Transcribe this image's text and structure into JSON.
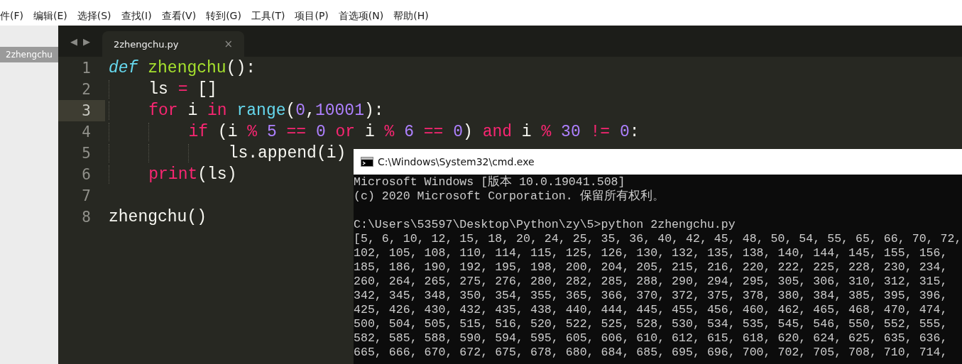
{
  "menu": [
    "件(F)",
    "编辑(E)",
    "选择(S)",
    "查找(I)",
    "查看(V)",
    "转到(G)",
    "工具(T)",
    "项目(P)",
    "首选项(N)",
    "帮助(H)"
  ],
  "sidebar": {
    "items": [
      {
        "label": "2zhengchu",
        "selected": true
      }
    ]
  },
  "tabs": [
    {
      "label": "2zhengchu.py",
      "selected": true,
      "close": "×"
    }
  ],
  "nav": [
    "◀",
    "▶"
  ],
  "code": [
    {
      "number": "1",
      "current": false,
      "tokens": [
        {
          "kind": "storage",
          "text": "def"
        },
        {
          "kind": "func",
          "text": " zhengchu"
        },
        {
          "kind": "plain",
          "text": "():"
        }
      ]
    },
    {
      "number": "2",
      "current": false,
      "tokens": [
        {
          "kind": "plain",
          "text": "    ls "
        },
        {
          "kind": "keyword",
          "text": "="
        },
        {
          "kind": "plain",
          "text": " []"
        }
      ]
    },
    {
      "number": "3",
      "current": true,
      "tokens": [
        {
          "kind": "keyword",
          "text": "    for"
        },
        {
          "kind": "plain",
          "text": " i "
        },
        {
          "kind": "keyword",
          "text": "in"
        },
        {
          "kind": "builtin",
          "text": " range"
        },
        {
          "kind": "plain",
          "text": "("
        },
        {
          "kind": "number",
          "text": "0"
        },
        {
          "kind": "plain",
          "text": ","
        },
        {
          "kind": "number",
          "text": "10001"
        },
        {
          "kind": "plain",
          "text": "):"
        }
      ]
    },
    {
      "number": "4",
      "current": false,
      "tokens": [
        {
          "kind": "keyword",
          "text": "        if"
        },
        {
          "kind": "plain",
          "text": " (i "
        },
        {
          "kind": "keyword",
          "text": "%"
        },
        {
          "kind": "number",
          "text": " 5"
        },
        {
          "kind": "keyword",
          "text": " =="
        },
        {
          "kind": "number",
          "text": " 0"
        },
        {
          "kind": "keyword",
          "text": " or"
        },
        {
          "kind": "plain",
          "text": " i "
        },
        {
          "kind": "keyword",
          "text": "%"
        },
        {
          "kind": "number",
          "text": " 6"
        },
        {
          "kind": "keyword",
          "text": " =="
        },
        {
          "kind": "number",
          "text": " 0"
        },
        {
          "kind": "plain",
          "text": ") "
        },
        {
          "kind": "keyword",
          "text": "and"
        },
        {
          "kind": "plain",
          "text": " i "
        },
        {
          "kind": "keyword",
          "text": "%"
        },
        {
          "kind": "number",
          "text": " 30"
        },
        {
          "kind": "keyword",
          "text": " !="
        },
        {
          "kind": "number",
          "text": " 0"
        },
        {
          "kind": "plain",
          "text": ":"
        }
      ]
    },
    {
      "number": "5",
      "current": false,
      "tokens": [
        {
          "kind": "plain",
          "text": "            ls.append(i)"
        }
      ]
    },
    {
      "number": "6",
      "current": false,
      "tokens": [
        {
          "kind": "keyword",
          "text": "    print"
        },
        {
          "kind": "plain",
          "text": "(ls)"
        }
      ]
    },
    {
      "number": "7",
      "current": false
    },
    {
      "number": "8",
      "current": false,
      "tokens": [
        {
          "kind": "plain",
          "text": "zhengchu()"
        }
      ]
    }
  ],
  "console": {
    "title": "C:\\Windows\\System32\\cmd.exe",
    "header": [
      "Microsoft Windows [版本 10.0.19041.508]",
      "(c) 2020 Microsoft Corporation. 保留所有权利。"
    ],
    "prompt": "C:\\Users\\53597\\Desktop\\Python\\zy\\5>python 2zhengchu.py",
    "output": [
      "[5, 6, 10, 12, 15, 18, 20, 24, 25, 35, 36, 40, 42, 45, 48, 50, 54, 55, 65, 66, 70, 72,",
      "102, 105, 108, 110, 114, 115, 125, 126, 130, 132, 135, 138, 140, 144, 145, 155, 156,",
      "185, 186, 190, 192, 195, 198, 200, 204, 205, 215, 216, 220, 222, 225, 228, 230, 234,",
      "260, 264, 265, 275, 276, 280, 282, 285, 288, 290, 294, 295, 305, 306, 310, 312, 315,",
      "342, 345, 348, 350, 354, 355, 365, 366, 370, 372, 375, 378, 380, 384, 385, 395, 396,",
      "425, 426, 430, 432, 435, 438, 440, 444, 445, 455, 456, 460, 462, 465, 468, 470, 474,",
      "500, 504, 505, 515, 516, 520, 522, 525, 528, 530, 534, 535, 545, 546, 550, 552, 555,",
      "582, 585, 588, 590, 594, 595, 605, 606, 610, 612, 615, 618, 620, 624, 625, 635, 636,",
      "665, 666, 670, 672, 675, 678, 680, 684, 685, 695, 696, 700, 702, 705, 708, 710, 714,"
    ]
  }
}
